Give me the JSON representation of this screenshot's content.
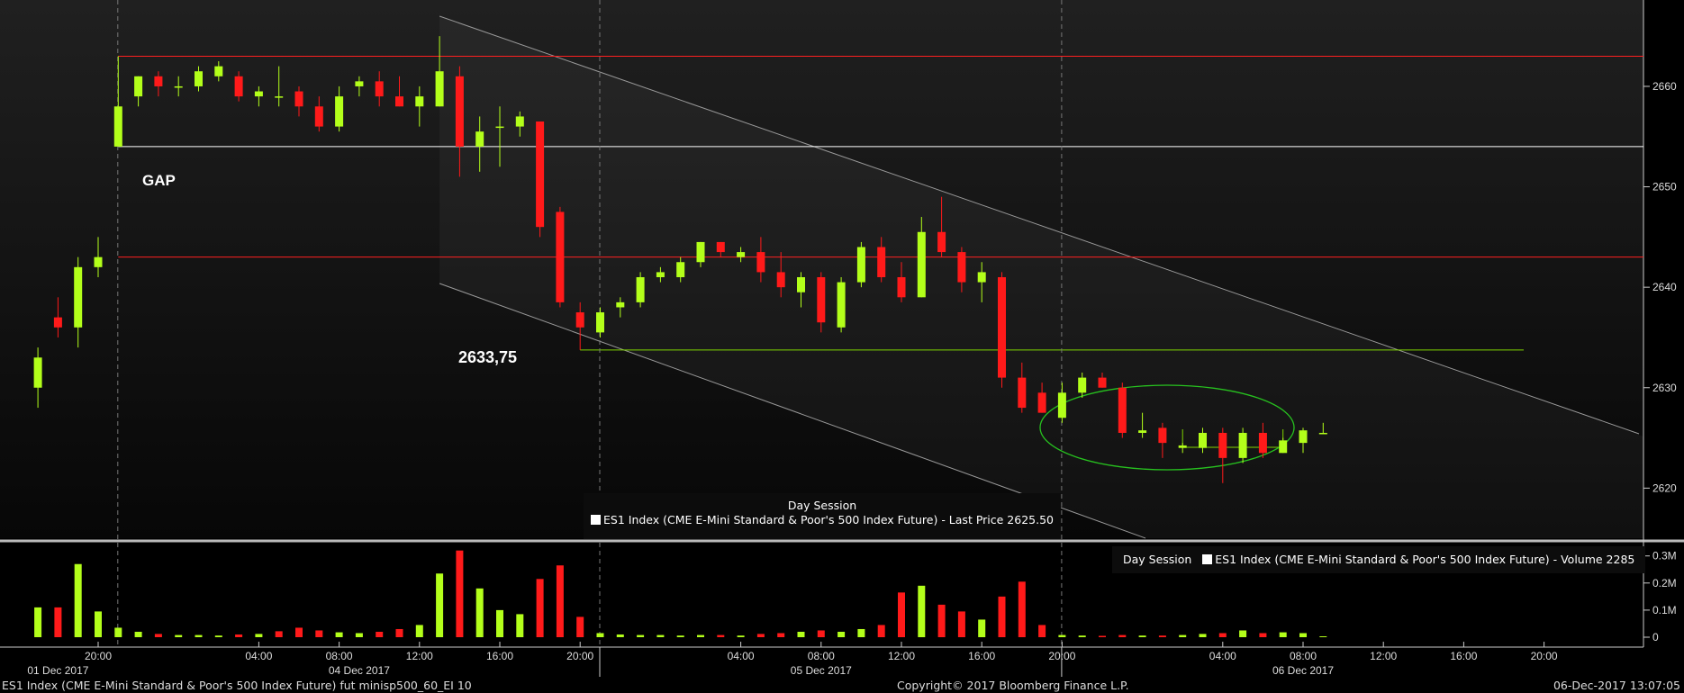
{
  "chart_data": [
    {
      "type": "candlestick",
      "panel": "price",
      "x_unit": "hours since 01 Dec 2017 00:00 (hourly bars)",
      "ylim": [
        2612,
        2670
      ],
      "y_ticks": [
        2620,
        2630,
        2640,
        2650,
        2660
      ],
      "candles": [
        {
          "t": 17,
          "o": 2630,
          "h": 2634,
          "l": 2628,
          "c": 2633
        },
        {
          "t": 18,
          "o": 2637,
          "h": 2639,
          "l": 2635,
          "c": 2636
        },
        {
          "t": 19,
          "o": 2636,
          "h": 2643,
          "l": 2634,
          "c": 2642
        },
        {
          "t": 20,
          "o": 2642,
          "h": 2645,
          "l": 2641,
          "c": 2643
        },
        {
          "t": 21,
          "o": 2654,
          "h": 2663,
          "l": 2654,
          "c": 2658
        },
        {
          "t": 22,
          "o": 2659,
          "h": 2661,
          "l": 2658,
          "c": 2661
        },
        {
          "t": 23,
          "o": 2661,
          "h": 2661.5,
          "l": 2659,
          "c": 2660
        },
        {
          "t": 24,
          "o": 2660,
          "h": 2661,
          "l": 2659,
          "c": 2660
        },
        {
          "t": 25,
          "o": 2660,
          "h": 2662,
          "l": 2659.5,
          "c": 2661.5
        },
        {
          "t": 26,
          "o": 2661,
          "h": 2662.5,
          "l": 2660.5,
          "c": 2662
        },
        {
          "t": 27,
          "o": 2661,
          "h": 2661.5,
          "l": 2658.5,
          "c": 2659
        },
        {
          "t": 28,
          "o": 2659,
          "h": 2660,
          "l": 2658,
          "c": 2659.5
        },
        {
          "t": 29,
          "o": 2659,
          "h": 2662,
          "l": 2658,
          "c": 2659
        },
        {
          "t": 30,
          "o": 2659.5,
          "h": 2660,
          "l": 2657,
          "c": 2658
        },
        {
          "t": 31,
          "o": 2658,
          "h": 2659,
          "l": 2655.5,
          "c": 2656
        },
        {
          "t": 32,
          "o": 2656,
          "h": 2660,
          "l": 2655.5,
          "c": 2659
        },
        {
          "t": 33,
          "o": 2660,
          "h": 2661,
          "l": 2659,
          "c": 2660.5
        },
        {
          "t": 34,
          "o": 2660.5,
          "h": 2661.5,
          "l": 2658,
          "c": 2659
        },
        {
          "t": 35,
          "o": 2659,
          "h": 2661,
          "l": 2658,
          "c": 2658
        },
        {
          "t": 36,
          "o": 2658,
          "h": 2660,
          "l": 2656,
          "c": 2659
        },
        {
          "t": 37,
          "o": 2658,
          "h": 2665,
          "l": 2658,
          "c": 2661.5
        },
        {
          "t": 38,
          "o": 2661,
          "h": 2662,
          "l": 2651,
          "c": 2654
        },
        {
          "t": 39,
          "o": 2654,
          "h": 2657,
          "l": 2651.5,
          "c": 2655.5
        },
        {
          "t": 40,
          "o": 2656,
          "h": 2658,
          "l": 2652,
          "c": 2656
        },
        {
          "t": 41,
          "o": 2656,
          "h": 2657.5,
          "l": 2655,
          "c": 2657
        },
        {
          "t": 42,
          "o": 2656.5,
          "h": 2656.5,
          "l": 2645,
          "c": 2646
        },
        {
          "t": 43,
          "o": 2647.5,
          "h": 2648,
          "l": 2638,
          "c": 2638.5
        },
        {
          "t": 44,
          "o": 2637.5,
          "h": 2638.5,
          "l": 2633.75,
          "c": 2636
        },
        {
          "t": 45,
          "o": 2635.5,
          "h": 2638,
          "l": 2635,
          "c": 2637.5
        },
        {
          "t": 46,
          "o": 2638,
          "h": 2639,
          "l": 2637,
          "c": 2638.5
        },
        {
          "t": 47,
          "o": 2638.5,
          "h": 2641.5,
          "l": 2638,
          "c": 2641
        },
        {
          "t": 48,
          "o": 2641,
          "h": 2642,
          "l": 2640.5,
          "c": 2641.5
        },
        {
          "t": 49,
          "o": 2641,
          "h": 2643,
          "l": 2640.5,
          "c": 2642.5
        },
        {
          "t": 50,
          "o": 2642.5,
          "h": 2644.5,
          "l": 2642,
          "c": 2644.5
        },
        {
          "t": 51,
          "o": 2644.5,
          "h": 2644.5,
          "l": 2643,
          "c": 2643.5
        },
        {
          "t": 52,
          "o": 2643,
          "h": 2644,
          "l": 2642.5,
          "c": 2643.5
        },
        {
          "t": 53,
          "o": 2643.5,
          "h": 2645,
          "l": 2640.5,
          "c": 2641.5
        },
        {
          "t": 54,
          "o": 2641.5,
          "h": 2643.5,
          "l": 2639,
          "c": 2640
        },
        {
          "t": 55,
          "o": 2639.5,
          "h": 2641.5,
          "l": 2638,
          "c": 2641
        },
        {
          "t": 56,
          "o": 2641,
          "h": 2641.5,
          "l": 2635.5,
          "c": 2636.5
        },
        {
          "t": 57,
          "o": 2636,
          "h": 2641,
          "l": 2635.5,
          "c": 2640.5
        },
        {
          "t": 58,
          "o": 2640.5,
          "h": 2644.5,
          "l": 2640,
          "c": 2644
        },
        {
          "t": 59,
          "o": 2644,
          "h": 2645,
          "l": 2640.5,
          "c": 2641
        },
        {
          "t": 60,
          "o": 2641,
          "h": 2642.5,
          "l": 2638.5,
          "c": 2639
        },
        {
          "t": 61,
          "o": 2639,
          "h": 2647,
          "l": 2639,
          "c": 2645.5
        },
        {
          "t": 62,
          "o": 2645.5,
          "h": 2649,
          "l": 2643,
          "c": 2643.5
        },
        {
          "t": 63,
          "o": 2643.5,
          "h": 2644,
          "l": 2639.5,
          "c": 2640.5
        },
        {
          "t": 64,
          "o": 2640.5,
          "h": 2642.5,
          "l": 2638.5,
          "c": 2641.5
        },
        {
          "t": 65,
          "o": 2641,
          "h": 2641.5,
          "l": 2630,
          "c": 2631
        },
        {
          "t": 66,
          "o": 2631,
          "h": 2632.5,
          "l": 2627.5,
          "c": 2628
        },
        {
          "t": 67,
          "o": 2629.5,
          "h": 2630.5,
          "l": 2627.5,
          "c": 2627.5
        },
        {
          "t": 68,
          "o": 2627,
          "h": 2630.5,
          "l": 2626.5,
          "c": 2629.5
        },
        {
          "t": 69,
          "o": 2629.5,
          "h": 2631.5,
          "l": 2629,
          "c": 2631
        },
        {
          "t": 70,
          "o": 2631,
          "h": 2631.5,
          "l": 2630,
          "c": 2630
        },
        {
          "t": 71,
          "o": 2630,
          "h": 2630.5,
          "l": 2625,
          "c": 2625.5
        },
        {
          "t": 72,
          "o": 2625.5,
          "h": 2627.5,
          "l": 2625,
          "c": 2625.75
        },
        {
          "t": 73,
          "o": 2626,
          "h": 2626.5,
          "l": 2623,
          "c": 2624.5
        },
        {
          "t": 74,
          "o": 2624,
          "h": 2624.5,
          "l": 2623.5,
          "c": 2624.25
        },
        {
          "t": 75,
          "o": 2624,
          "h": 2626,
          "l": 2623.5,
          "c": 2625.5
        },
        {
          "t": 76,
          "o": 2625.5,
          "h": 2626,
          "l": 2620.5,
          "c": 2623
        },
        {
          "t": 77,
          "o": 2623,
          "h": 2626,
          "l": 2622.5,
          "c": 2625.5
        },
        {
          "t": 78,
          "o": 2625.5,
          "h": 2626.5,
          "l": 2623,
          "c": 2623.5
        },
        {
          "t": 79,
          "o": 2623.5,
          "h": 2625,
          "l": 2623.5,
          "c": 2624.75
        },
        {
          "t": 80,
          "o": 2624.5,
          "h": 2626,
          "l": 2623.5,
          "c": 2625.75
        },
        {
          "t": 81,
          "o": 2625.5,
          "h": 2626.5,
          "l": 2625.5,
          "c": 2625.5
        }
      ],
      "legend": [
        "Day Session",
        "ES1 Index (CME E-Mini Standard & Poor's 500 Index Future) - Last Price 2625.50"
      ],
      "annotations": [
        "GAP",
        "2633,75"
      ],
      "colors": {
        "up": "#b3ff1a",
        "down": "#ff1a1a"
      }
    },
    {
      "type": "bar",
      "panel": "volume",
      "ylim": [
        0,
        330000
      ],
      "y_tick_values": [
        0,
        100000,
        200000,
        300000
      ],
      "values": [
        {
          "t": 17,
          "v": 110000,
          "up": true
        },
        {
          "t": 18,
          "v": 110000,
          "up": false
        },
        {
          "t": 19,
          "v": 270000,
          "up": true
        },
        {
          "t": 20,
          "v": 95000,
          "up": true
        },
        {
          "t": 21,
          "v": 35000,
          "up": true
        },
        {
          "t": 22,
          "v": 20000,
          "up": true
        },
        {
          "t": 23,
          "v": 12000,
          "up": false
        },
        {
          "t": 24,
          "v": 8000,
          "up": true
        },
        {
          "t": 25,
          "v": 8000,
          "up": true
        },
        {
          "t": 26,
          "v": 6000,
          "up": true
        },
        {
          "t": 27,
          "v": 10000,
          "up": false
        },
        {
          "t": 28,
          "v": 12000,
          "up": true
        },
        {
          "t": 29,
          "v": 22000,
          "up": false
        },
        {
          "t": 30,
          "v": 35000,
          "up": false
        },
        {
          "t": 31,
          "v": 25000,
          "up": false
        },
        {
          "t": 32,
          "v": 18000,
          "up": true
        },
        {
          "t": 33,
          "v": 15000,
          "up": true
        },
        {
          "t": 34,
          "v": 20000,
          "up": false
        },
        {
          "t": 35,
          "v": 30000,
          "up": false
        },
        {
          "t": 36,
          "v": 45000,
          "up": true
        },
        {
          "t": 37,
          "v": 235000,
          "up": true
        },
        {
          "t": 38,
          "v": 320000,
          "up": false
        },
        {
          "t": 39,
          "v": 180000,
          "up": true
        },
        {
          "t": 40,
          "v": 100000,
          "up": true
        },
        {
          "t": 41,
          "v": 85000,
          "up": true
        },
        {
          "t": 42,
          "v": 215000,
          "up": false
        },
        {
          "t": 43,
          "v": 265000,
          "up": false
        },
        {
          "t": 44,
          "v": 75000,
          "up": false
        },
        {
          "t": 45,
          "v": 15000,
          "up": true
        },
        {
          "t": 46,
          "v": 10000,
          "up": true
        },
        {
          "t": 47,
          "v": 8000,
          "up": true
        },
        {
          "t": 48,
          "v": 8000,
          "up": true
        },
        {
          "t": 49,
          "v": 6000,
          "up": true
        },
        {
          "t": 50,
          "v": 8000,
          "up": true
        },
        {
          "t": 51,
          "v": 8000,
          "up": false
        },
        {
          "t": 52,
          "v": 6000,
          "up": true
        },
        {
          "t": 53,
          "v": 12000,
          "up": false
        },
        {
          "t": 54,
          "v": 15000,
          "up": false
        },
        {
          "t": 55,
          "v": 20000,
          "up": true
        },
        {
          "t": 56,
          "v": 25000,
          "up": false
        },
        {
          "t": 57,
          "v": 20000,
          "up": true
        },
        {
          "t": 58,
          "v": 30000,
          "up": true
        },
        {
          "t": 59,
          "v": 45000,
          "up": false
        },
        {
          "t": 60,
          "v": 165000,
          "up": false
        },
        {
          "t": 61,
          "v": 190000,
          "up": true
        },
        {
          "t": 62,
          "v": 120000,
          "up": false
        },
        {
          "t": 63,
          "v": 95000,
          "up": false
        },
        {
          "t": 64,
          "v": 65000,
          "up": true
        },
        {
          "t": 65,
          "v": 150000,
          "up": false
        },
        {
          "t": 66,
          "v": 205000,
          "up": false
        },
        {
          "t": 67,
          "v": 45000,
          "up": false
        },
        {
          "t": 68,
          "v": 8000,
          "up": true
        },
        {
          "t": 69,
          "v": 6000,
          "up": true
        },
        {
          "t": 70,
          "v": 5000,
          "up": false
        },
        {
          "t": 71,
          "v": 8000,
          "up": false
        },
        {
          "t": 72,
          "v": 6000,
          "up": true
        },
        {
          "t": 73,
          "v": 6000,
          "up": false
        },
        {
          "t": 74,
          "v": 8000,
          "up": true
        },
        {
          "t": 75,
          "v": 12000,
          "up": true
        },
        {
          "t": 76,
          "v": 15000,
          "up": false
        },
        {
          "t": 77,
          "v": 25000,
          "up": true
        },
        {
          "t": 78,
          "v": 15000,
          "up": false
        },
        {
          "t": 79,
          "v": 18000,
          "up": true
        },
        {
          "t": 80,
          "v": 15000,
          "up": true
        },
        {
          "t": 81,
          "v": 3000,
          "up": true
        }
      ],
      "legend": [
        "Day Session",
        "ES1 Index (CME E-Mini Standard & Poor's 500 Index Future) - Volume 2285"
      ]
    }
  ],
  "price_axis_labels": [
    "2620",
    "2630",
    "2640",
    "2650",
    "2660"
  ],
  "volume_axis_labels": [
    "0",
    "0.1M",
    "0.2M",
    "0.3M"
  ],
  "horizontal_levels": [
    {
      "price": 2663,
      "color": "#ff2020"
    },
    {
      "price": 2654,
      "color": "#ffffff"
    },
    {
      "price": 2643,
      "color": "#ff2020"
    },
    {
      "price": 2633.75,
      "color": "#7fd400"
    }
  ],
  "time_axis": {
    "hour_labels": [
      {
        "t": 20,
        "text": "20:00"
      },
      {
        "t": 28,
        "text": "04:00"
      },
      {
        "t": 32,
        "text": "08:00"
      },
      {
        "t": 36,
        "text": "12:00"
      },
      {
        "t": 40,
        "text": "16:00"
      },
      {
        "t": 44,
        "text": "20:00"
      },
      {
        "t": 52,
        "text": "04:00"
      },
      {
        "t": 56,
        "text": "08:00"
      },
      {
        "t": 60,
        "text": "12:00"
      },
      {
        "t": 64,
        "text": "16:00"
      },
      {
        "t": 68,
        "text": "20:00"
      },
      {
        "t": 76,
        "text": "04:00"
      },
      {
        "t": 80,
        "text": "08:00"
      },
      {
        "t": 84,
        "text": "12:00"
      },
      {
        "t": 88,
        "text": "16:00"
      },
      {
        "t": 92,
        "text": "20:00"
      }
    ],
    "date_labels": [
      {
        "t": 18,
        "text": "01 Dec 2017"
      },
      {
        "t": 33,
        "text": "04 Dec 2017"
      },
      {
        "t": 56,
        "text": "05 Dec 2017"
      },
      {
        "t": 80,
        "text": "06 Dec 2017"
      }
    ],
    "session_breaks": [
      21,
      45,
      68
    ]
  },
  "annotations": {
    "gap": "GAP",
    "low_price": "2633,75"
  },
  "price_legend": {
    "session": "Day Session",
    "series": "ES1 Index (CME E-Mini Standard & Poor's 500 Index Future) - Last Price 2625.50"
  },
  "volume_legend": {
    "session": "Day Session",
    "series": "ES1 Index (CME E-Mini Standard & Poor's 500 Index Future) - Volume 2285"
  },
  "footer": {
    "left": "ES1 Index (CME E-Mini Standard & Poor's 500 Index Future) fut minisp500_60_EI 10",
    "center": "Copyright© 2017 Bloomberg Finance L.P.",
    "right": "06-Dec-2017 13:07:05"
  },
  "colors": {
    "up": "#b3ff1a",
    "down": "#ff1a1a",
    "background": "#000000"
  }
}
